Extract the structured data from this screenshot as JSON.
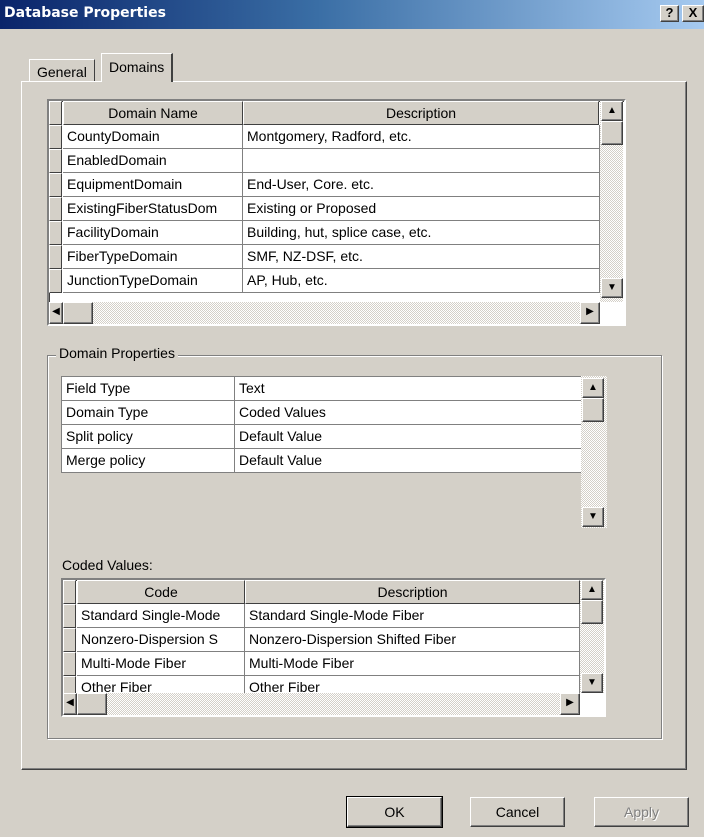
{
  "window": {
    "title": "Database Properties",
    "help_button": "?",
    "close_button": "X"
  },
  "tabs": [
    {
      "label": "General",
      "selected": false
    },
    {
      "label": "Domains",
      "selected": true
    }
  ],
  "domains_table": {
    "columns": [
      "Domain Name",
      "Description"
    ],
    "rows": [
      {
        "name": "CountyDomain",
        "description": "Montgomery, Radford, etc."
      },
      {
        "name": "EnabledDomain",
        "description": ""
      },
      {
        "name": "EquipmentDomain",
        "description": "End-User, Core. etc."
      },
      {
        "name": "ExistingFiberStatusDom",
        "description": "Existing or Proposed"
      },
      {
        "name": "FacilityDomain",
        "description": "Building, hut, splice case, etc."
      },
      {
        "name": "FiberTypeDomain",
        "description": "SMF, NZ-DSF, etc."
      },
      {
        "name": "JunctionTypeDomain",
        "description": "AP, Hub, etc."
      }
    ]
  },
  "domain_properties": {
    "group_label": "Domain Properties",
    "rows": [
      {
        "field": "Field Type",
        "value": "Text"
      },
      {
        "field": "Domain Type",
        "value": "Coded Values"
      },
      {
        "field": "Split policy",
        "value": "Default Value"
      },
      {
        "field": "Merge policy",
        "value": "Default Value"
      }
    ]
  },
  "coded_values": {
    "label": "Coded Values:",
    "columns": [
      "Code",
      "Description"
    ],
    "rows": [
      {
        "code": "Standard Single-Mode",
        "description": "Standard Single-Mode Fiber"
      },
      {
        "code": "Nonzero-Dispersion S",
        "description": "Nonzero-Dispersion Shifted Fiber"
      },
      {
        "code": "Multi-Mode Fiber",
        "description": "Multi-Mode Fiber"
      },
      {
        "code": "Other Fiber",
        "description": "Other Fiber"
      }
    ]
  },
  "buttons": {
    "ok": "OK",
    "cancel": "Cancel",
    "apply": "Apply",
    "apply_enabled": false
  },
  "icons": {
    "scroll_up": "up-arrow-icon",
    "scroll_down": "down-arrow-icon",
    "scroll_left": "left-arrow-icon",
    "scroll_right": "right-arrow-icon"
  }
}
